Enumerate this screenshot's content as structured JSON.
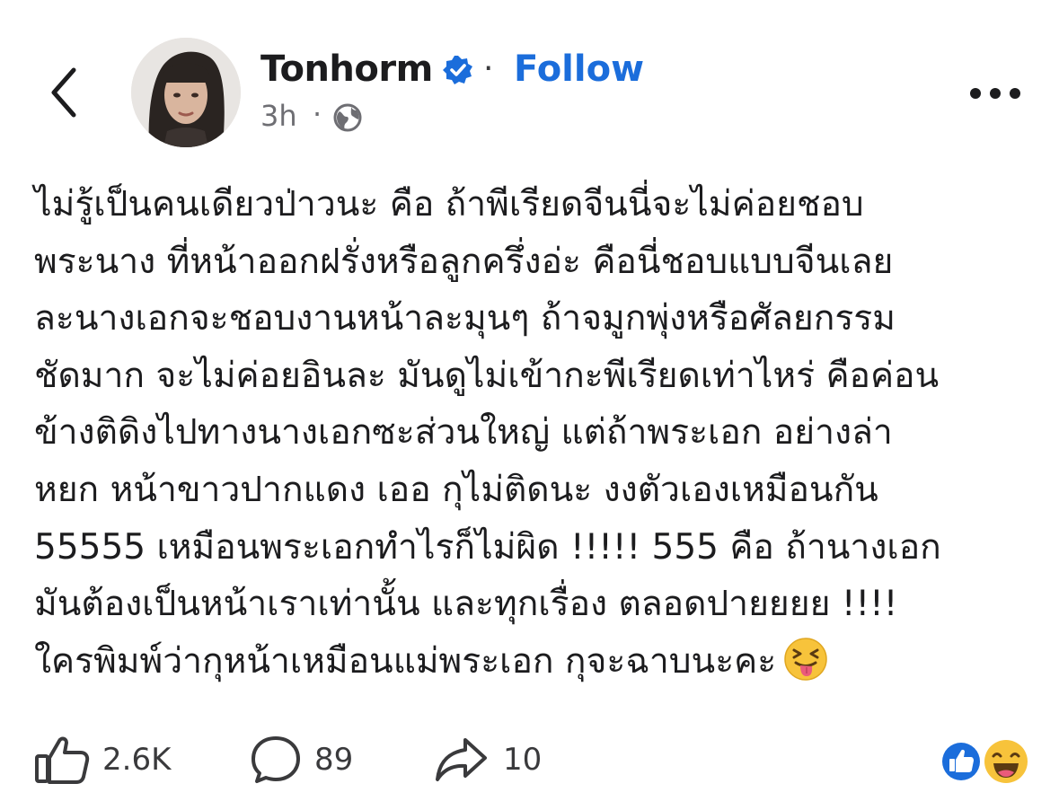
{
  "header": {
    "author_name": "Tonhorm",
    "follow_label": "Follow",
    "separator": "·",
    "time_ago": "3h",
    "time_separator": "·"
  },
  "icons": {
    "back": "chevron-left-icon",
    "verified": "verified-badge-icon",
    "audience": "globe-icon",
    "more": "more-dots-icon",
    "like": "thumbs-up-icon",
    "comment": "comment-bubble-icon",
    "share": "share-arrow-icon",
    "post_emoji": "squinting-tongue-emoji",
    "reaction_like": "like-reaction-icon",
    "reaction_haha": "haha-reaction-icon"
  },
  "colors": {
    "accent": "#1b6ddb",
    "text": "#1c1c1e",
    "muted": "#6e6e73"
  },
  "post": {
    "lines": [
      "ไม่รู้เป็นคนเดียวป่าวนะ คือ ถ้าพีเรียดจีนนี่จะไม่ค่อยชอบ",
      "พระนาง ที่หน้าออกฝรั่งหรือลูกครึ่งอ่ะ คือนี่ชอบแบบจีนเลย",
      "ละนางเอกจะชอบงานหน้าละมุนๆ ถ้าจมูกพุ่งหรือศัลยกรรม",
      "ชัดมาก จะไม่ค่อยอินละ มันดูไม่เข้ากะพีเรียดเท่าไหร่ คือค่อน",
      "ข้างติดิงไปทางนางเอกซะส่วนใหญ่ แต่ถ้าพระเอก อย่างล่า",
      "หยก หน้าขาวปากแดง เออ กุไม่ติดนะ งงตัวเองเหมือนกัน",
      "55555 เหมือนพระเอกทำไรก็ไม่ผิด !!!!! 555 คือ ถ้านางเอก",
      "มันต้องเป็นหน้าเราเท่านั้น และทุกเรื่อง ตลอดปายยยย !!!!",
      "ใครพิมพ์ว่ากุหน้าเหมือนแม่พระเอก กุจะฉาบนะคะ"
    ]
  },
  "actions": {
    "likes": "2.6K",
    "comments": "89",
    "shares": "10"
  }
}
